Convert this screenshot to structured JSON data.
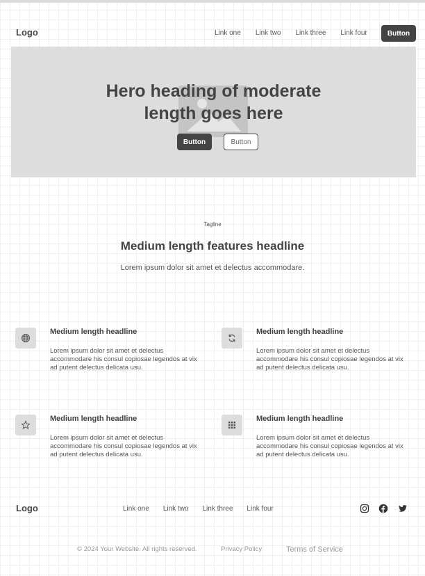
{
  "nav": {
    "logo": "Logo",
    "links": [
      "Link one",
      "Link two",
      "Link three",
      "Link four"
    ],
    "button": "Button"
  },
  "hero": {
    "title_line1": "Hero heading of moderate",
    "title_line2": "length goes here",
    "primary_button": "Button",
    "secondary_button": "Button",
    "image_icon": "image-placeholder-icon"
  },
  "features": {
    "tagline": "Tagline",
    "title": "Medium length features headline",
    "description": "Lorem ipsum dolor sit amet et delectus accommodare.",
    "items": [
      {
        "icon": "globe-icon",
        "title": "Medium length headline",
        "body": "Lorem ipsum dolor sit amet et delectus accommodare his consul copiosae legendos at vix ad putent delectus delicata usu."
      },
      {
        "icon": "refresh-icon",
        "title": "Medium length headline",
        "body": "Lorem ipsum dolor sit amet et delectus accommodare his consul copiosae legendos at vix ad putent delectus delicata usu."
      },
      {
        "icon": "star-icon",
        "title": "Medium length headline",
        "body": "Lorem ipsum dolor sit amet et delectus accommodare his consul copiosae legendos at vix ad putent delectus delicata usu."
      },
      {
        "icon": "grid-icon",
        "title": "Medium length headline",
        "body": "Lorem ipsum dolor sit amet et delectus accommodare his consul copiosae legendos at vix ad putent delectus delicata usu."
      }
    ]
  },
  "footer": {
    "logo": "Logo",
    "links": [
      "Link one",
      "Link two",
      "Link three",
      "Link four"
    ],
    "social": [
      "instagram-icon",
      "facebook-icon",
      "twitter-icon"
    ],
    "copyright": "© 2024 Your Website. All rights reserved.",
    "privacy": "Privacy Policy",
    "terms": "Terms of Service"
  },
  "colors": {
    "dark": "#444444",
    "placeholder": "#dddddd",
    "muted": "#999999"
  }
}
